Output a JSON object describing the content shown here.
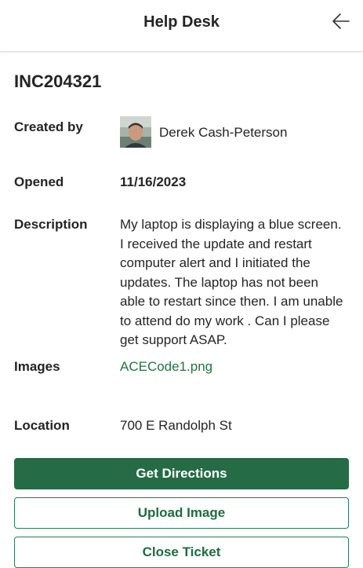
{
  "header": {
    "title": "Help Desk",
    "back_icon": "arrow-left-icon"
  },
  "ticket": {
    "id": "INC204321",
    "created_by_label": "Created by",
    "created_by_name": "Derek Cash-Peterson",
    "opened_label": "Opened",
    "opened_value": "11/16/2023",
    "description_label": "Description",
    "description_lines": [
      "My laptop is displaying a blue screen.",
      "I received the update and restart",
      "computer alert and I initiated the",
      "updates. The laptop has not been",
      "able to restart since then. I am unable",
      "to attend do my work . Can I please",
      "get support ASAP."
    ],
    "images_label": "Images",
    "image_file": "ACECode1.png",
    "location_label": "Location",
    "location_value": "700 E Randolph St"
  },
  "actions": {
    "get_directions": "Get Directions",
    "upload_image": "Upload Image",
    "close_ticket": "Close Ticket"
  },
  "colors": {
    "accent": "#256b45",
    "link": "#217346"
  }
}
